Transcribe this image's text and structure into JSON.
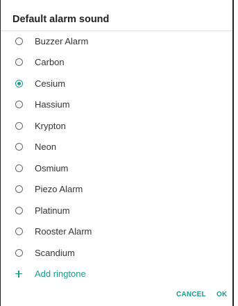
{
  "dialog": {
    "title": "Default alarm sound",
    "options": [
      {
        "label": "Buzzer Alarm",
        "checked": false
      },
      {
        "label": "Carbon",
        "checked": false
      },
      {
        "label": "Cesium",
        "checked": true
      },
      {
        "label": "Hassium",
        "checked": false
      },
      {
        "label": "Krypton",
        "checked": false
      },
      {
        "label": "Neon",
        "checked": false
      },
      {
        "label": "Osmium",
        "checked": false
      },
      {
        "label": "Piezo Alarm",
        "checked": false
      },
      {
        "label": "Platinum",
        "checked": false
      },
      {
        "label": "Rooster Alarm",
        "checked": false
      },
      {
        "label": "Scandium",
        "checked": false
      }
    ],
    "add_ringtone_label": "Add ringtone",
    "cancel_label": "CANCEL",
    "ok_label": "OK"
  },
  "colors": {
    "accent": "#1a9e8a",
    "text": "#333333",
    "radio_unchecked": "#666666"
  },
  "icons": {
    "add": "plus-icon",
    "radio": "radio-button-icon"
  }
}
